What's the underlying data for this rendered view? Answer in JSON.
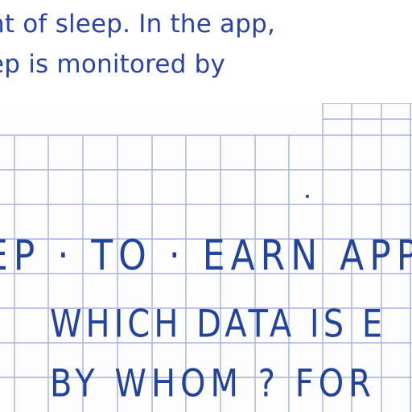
{
  "printed": {
    "line1": "ht of sleep. In the app,",
    "line2": "ep is monitored by"
  },
  "handwritten": {
    "line1": "EP · TO · EARN APP",
    "line2": "WHICH DATA IS E",
    "line3": "BY WHOM ? FOR"
  },
  "colors": {
    "printed_ink": "#2a44a6",
    "handwriting_ink": "#22449a",
    "grid": "#9aa6d6"
  }
}
